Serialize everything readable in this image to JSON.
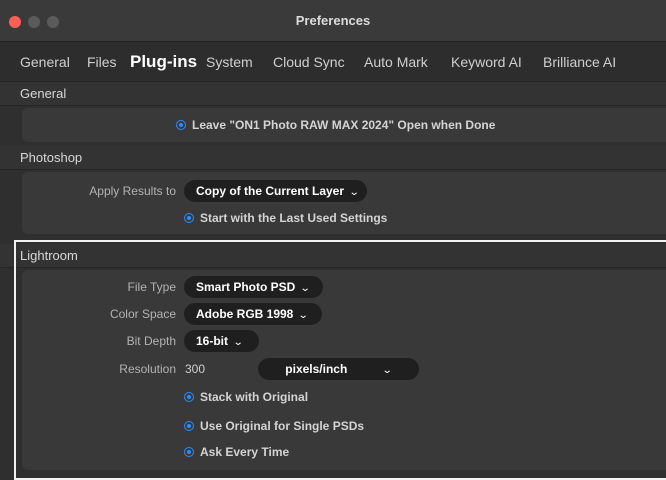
{
  "window": {
    "title": "Preferences"
  },
  "tabs": [
    {
      "label": "General"
    },
    {
      "label": "Files"
    },
    {
      "label": "Plug-ins"
    },
    {
      "label": "System"
    },
    {
      "label": "Cloud Sync"
    },
    {
      "label": "Auto Mark"
    },
    {
      "label": "Keyword AI"
    },
    {
      "label": "Brilliance AI"
    }
  ],
  "active_tab": "Plug-ins",
  "general": {
    "header": "General",
    "leave_open_label": "Leave \"ON1 Photo RAW MAX 2024\" Open when Done"
  },
  "photoshop": {
    "header": "Photoshop",
    "apply_results_label": "Apply Results to",
    "apply_results_value": "Copy of the Current Layer",
    "start_last_used_label": "Start with the Last Used Settings"
  },
  "lightroom": {
    "header": "Lightroom",
    "file_type_label": "File Type",
    "file_type_value": "Smart Photo PSD",
    "color_space_label": "Color Space",
    "color_space_value": "Adobe RGB 1998",
    "bit_depth_label": "Bit Depth",
    "bit_depth_value": "16-bit",
    "resolution_label": "Resolution",
    "resolution_value": "300",
    "resolution_unit": "pixels/inch",
    "stack_label": "Stack with Original",
    "use_original_label": "Use Original for Single PSDs",
    "ask_every_time_label": "Ask Every Time"
  },
  "icons": {
    "dropdown": "chevron-down-icon",
    "radio": "radio-selected-icon"
  },
  "colors": {
    "accent": "#2d8cff",
    "close": "#ff5f57"
  }
}
